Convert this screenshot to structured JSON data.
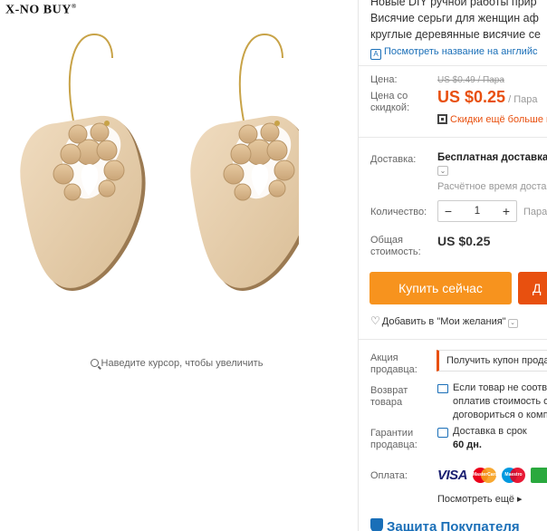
{
  "brand": {
    "name": "X-NO BUY",
    "mark": "®"
  },
  "image": {
    "zoom_hint": "Наведите курсор, чтобы увеличить"
  },
  "product": {
    "title_lines": [
      "Новые DIY ручной работы прир",
      "Висячие серьги для женщин аф",
      "круглые деревянные висячие се"
    ],
    "translate_link": "Посмотреть название на английс"
  },
  "price": {
    "label": "Цена:",
    "old_value": "US $0.49 / Пара",
    "discount_label": "Цена со скидкой:",
    "new_value": "US $0.25",
    "unit": "/ Пара",
    "app_discount": "Скидки ещё больше в"
  },
  "shipping": {
    "label": "Доставка:",
    "value": "Бесплатная доставка в",
    "estimate": "Расчётное время достав"
  },
  "quantity": {
    "label": "Количество:",
    "value": "1",
    "minus": "−",
    "plus": "+",
    "unit": "Пара"
  },
  "total": {
    "label": "Общая стоимость:",
    "value": "US $0.25"
  },
  "actions": {
    "buy_now": "Купить сейчас",
    "add_to_cart": "Д",
    "wishlist": "Добавить в \"Мои желания\""
  },
  "seller_promo": {
    "label": "Акция продавца:",
    "value": "Получить купон прода"
  },
  "returns": {
    "label": "Возврат товара",
    "lines": [
      "Если товар не соотве",
      "оплатив стоимость о",
      "договориться о комп"
    ]
  },
  "guarantee": {
    "label": "Гарантии продавца:",
    "line1": "Доставка в срок",
    "line2": "60 дн."
  },
  "payment": {
    "label": "Оплата:",
    "methods": [
      "VISA",
      "MasterCard",
      "Maestro"
    ],
    "more": "Посмотреть ещё ▸"
  },
  "protection": {
    "title": "Защита Покупателя"
  },
  "colors": {
    "accent": "#e8500f",
    "buy_button": "#f7931e",
    "link": "#1a6fb8"
  }
}
